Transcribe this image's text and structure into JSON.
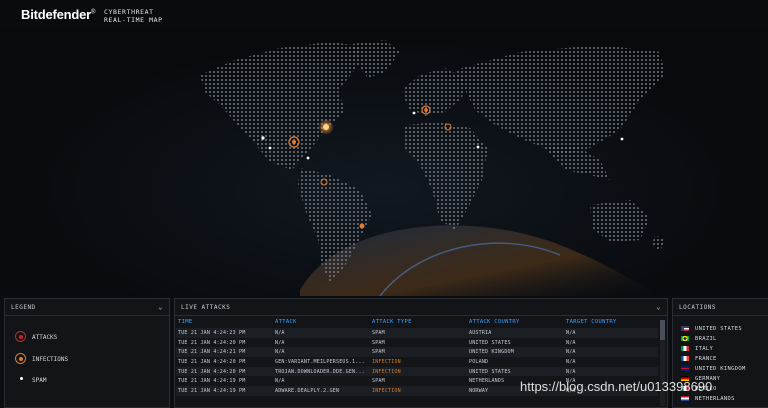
{
  "header": {
    "brand": "Bitdefender",
    "brand_mark": "®",
    "subtitle_line1": "CYBERTHREAT",
    "subtitle_line2": "REAL-TIME MAP"
  },
  "legend": {
    "title": "LEGEND",
    "items": [
      {
        "label": "ATTACKS",
        "color": "#c0262a"
      },
      {
        "label": "INFECTIONS",
        "color": "#e07b2e"
      },
      {
        "label": "SPAM",
        "color": "#ffffff"
      }
    ]
  },
  "live_attacks": {
    "title": "LIVE ATTACKS",
    "columns": [
      "TIME",
      "ATTACK",
      "ATTACK TYPE",
      "ATTACK COUNTRY",
      "TARGET COUNTRY"
    ],
    "rows": [
      [
        "TUE 21 JAN 4:24:23 PM",
        "N/A",
        "SPAM",
        "AUSTRIA",
        "N/A"
      ],
      [
        "TUE 21 JAN 4:24:20 PM",
        "N/A",
        "SPAM",
        "UNITED STATES",
        "N/A"
      ],
      [
        "TUE 21 JAN 4:24:21 PM",
        "N/A",
        "SPAM",
        "UNITED KINGDOM",
        "N/A"
      ],
      [
        "TUE 21 JAN 4:24:20 PM",
        "GEN:VARIANT.MEILPERSEUS.1...",
        "INFECTION",
        "POLAND",
        "N/A"
      ],
      [
        "TUE 21 JAN 4:24:20 PM",
        "TROJAN.DOWNLOADER.DDE.GEN...",
        "INFECTION",
        "UNITED STATES",
        "N/A"
      ],
      [
        "TUE 21 JAN 4:24:19 PM",
        "N/A",
        "SPAM",
        "NETHERLANDS",
        "N/A"
      ],
      [
        "TUE 21 JAN 4:24:19 PM",
        "ADWARE.DEALPLY.2.GEN",
        "INFECTION",
        "NORWAY",
        "N/A"
      ]
    ]
  },
  "locations": {
    "title": "LOCATIONS",
    "items": [
      {
        "label": "UNITED STATES",
        "flag": "us-flag-icon"
      },
      {
        "label": "BRAZIL",
        "flag": "brazil-flag-icon"
      },
      {
        "label": "ITALY",
        "flag": "italy-flag-icon"
      },
      {
        "label": "FRANCE",
        "flag": "france-flag-icon"
      },
      {
        "label": "UNITED KINGDOM",
        "flag": "uk-flag-icon"
      },
      {
        "label": "GERMANY",
        "flag": "germany-flag-icon"
      },
      {
        "label": "MEXICO",
        "flag": "mexico-flag-icon"
      },
      {
        "label": "NETHERLANDS",
        "flag": "netherlands-flag-icon"
      }
    ]
  },
  "watermark": "https://blog.csdn.net/u013398690",
  "colors": {
    "accent_blue": "#3ea3ff",
    "infection_orange": "#d77a2a",
    "attack_red": "#c0262a"
  }
}
